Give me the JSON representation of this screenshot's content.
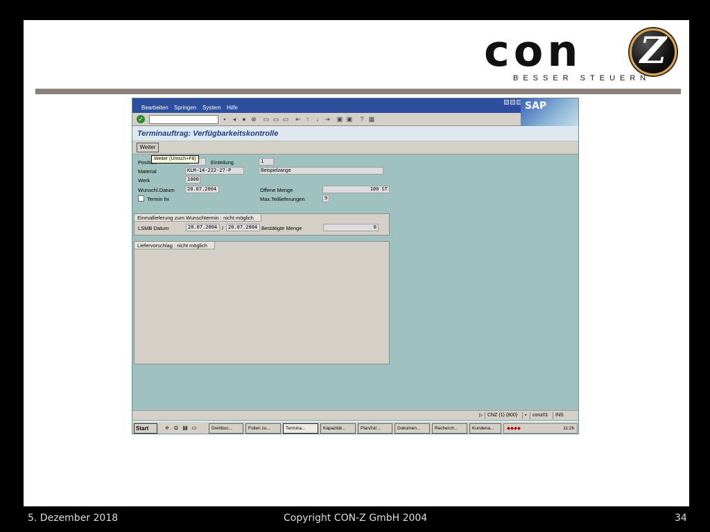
{
  "logo": {
    "word": "con",
    "emblem": "Z",
    "tagline": "BESSER STEUERN"
  },
  "footer": {
    "date": "5. Dezember 2018",
    "copyright": "Copyright CON-Z GmbH 2004",
    "page": "34"
  },
  "sap": {
    "menu": [
      "Bearbeiten",
      "Springen",
      "System",
      "Hilfe"
    ],
    "logo_text": "SAP",
    "command_field": "",
    "title": "Terminauftrag: Verfügbarkeitskontrolle",
    "weiter_button": "Weiter",
    "tooltip": "Weiter  (Umsch+F8)",
    "header": {
      "position_label": "Position",
      "einteilung_label": "Einteilung",
      "einteilung_value": "1",
      "material_label": "Material",
      "material_value": "KLM-14-222-27-P",
      "material_desc": "Beispielzange",
      "werk_label": "Werk",
      "werk_value": "1000",
      "wunsch_label": "Wunschl.Datum",
      "wunsch_value": "20.07.2004",
      "offene_label": "Offene Menge",
      "offene_value": "100 ST",
      "termin_fix_label": "Termin fix",
      "max_teil_label": "Max.Teillieferungen",
      "max_teil_value": "9"
    },
    "einmal": {
      "title": "Einmallieferung zum Wunschtermin : nicht möglich",
      "lsmb_label": "LSMB Datum",
      "lsmb_from": "20.07.2004",
      "sep": "/",
      "lsmb_to": "20.07.2004",
      "bestaetigt_label": "Bestätigte Menge",
      "bestaetigt_value": "0"
    },
    "liefer": {
      "title": "Liefervorschlag : nicht möglich"
    },
    "status": {
      "system": "CNZ (1) (800)",
      "user": "conz01",
      "mode": "INS"
    },
    "taskbar": {
      "start": "Start",
      "tasks": [
        "Drehbuc...",
        "Folien zu...",
        "Termina...",
        "Kapazität...",
        "Plan/Ist/...",
        "Dokumen...",
        "Recherch...",
        "Kundena..."
      ],
      "clock": "11:26"
    }
  }
}
